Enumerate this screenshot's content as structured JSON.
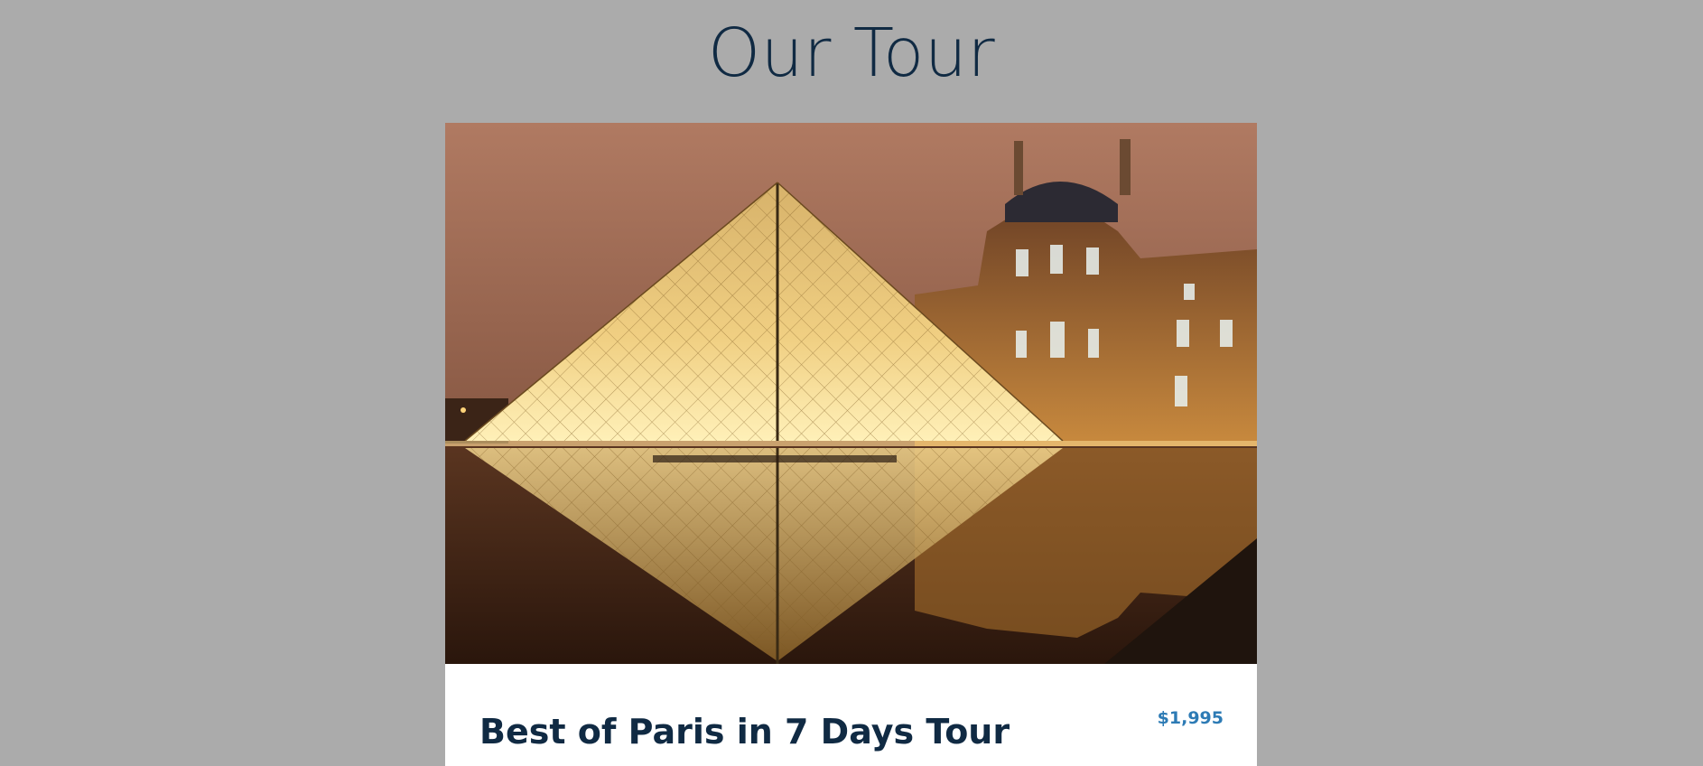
{
  "header": {
    "title": "Our Tour"
  },
  "tour": {
    "name": "Best of Paris in 7 Days Tour",
    "price": "$1,995",
    "image_subject": "louvre-pyramid-photo"
  },
  "colors": {
    "background": "#ababab",
    "title": "#102a43",
    "card": "#ffffff",
    "price": "#2d7bb5"
  }
}
